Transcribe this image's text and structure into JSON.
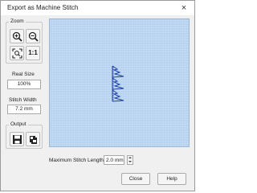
{
  "window": {
    "title": "Export as Machine Stitch",
    "close_glyph": "×"
  },
  "zoom_group": {
    "label": "Zoom",
    "buttons": [
      {
        "icon": "zoom-in-icon"
      },
      {
        "icon": "zoom-out-icon"
      },
      {
        "icon": "zoom-fit-icon"
      },
      {
        "icon": "actual-size-icon",
        "text": "1:1"
      }
    ]
  },
  "real_size": {
    "label": "Real Size",
    "value": "100%"
  },
  "stitch_width": {
    "label": "Stitch Width",
    "value": "7.2 mm"
  },
  "output_group": {
    "label": "Output",
    "buttons": [
      {
        "icon": "save-icon"
      },
      {
        "icon": "send-to-machine-icon"
      }
    ]
  },
  "preview": {
    "background_color": "#b7d3ef",
    "stitch_color": "#1f3fa8"
  },
  "max_stitch_length": {
    "label": "Maximum Stitch Length",
    "value": "2.0 mm"
  },
  "buttons": {
    "close": "Close",
    "help": "Help"
  }
}
